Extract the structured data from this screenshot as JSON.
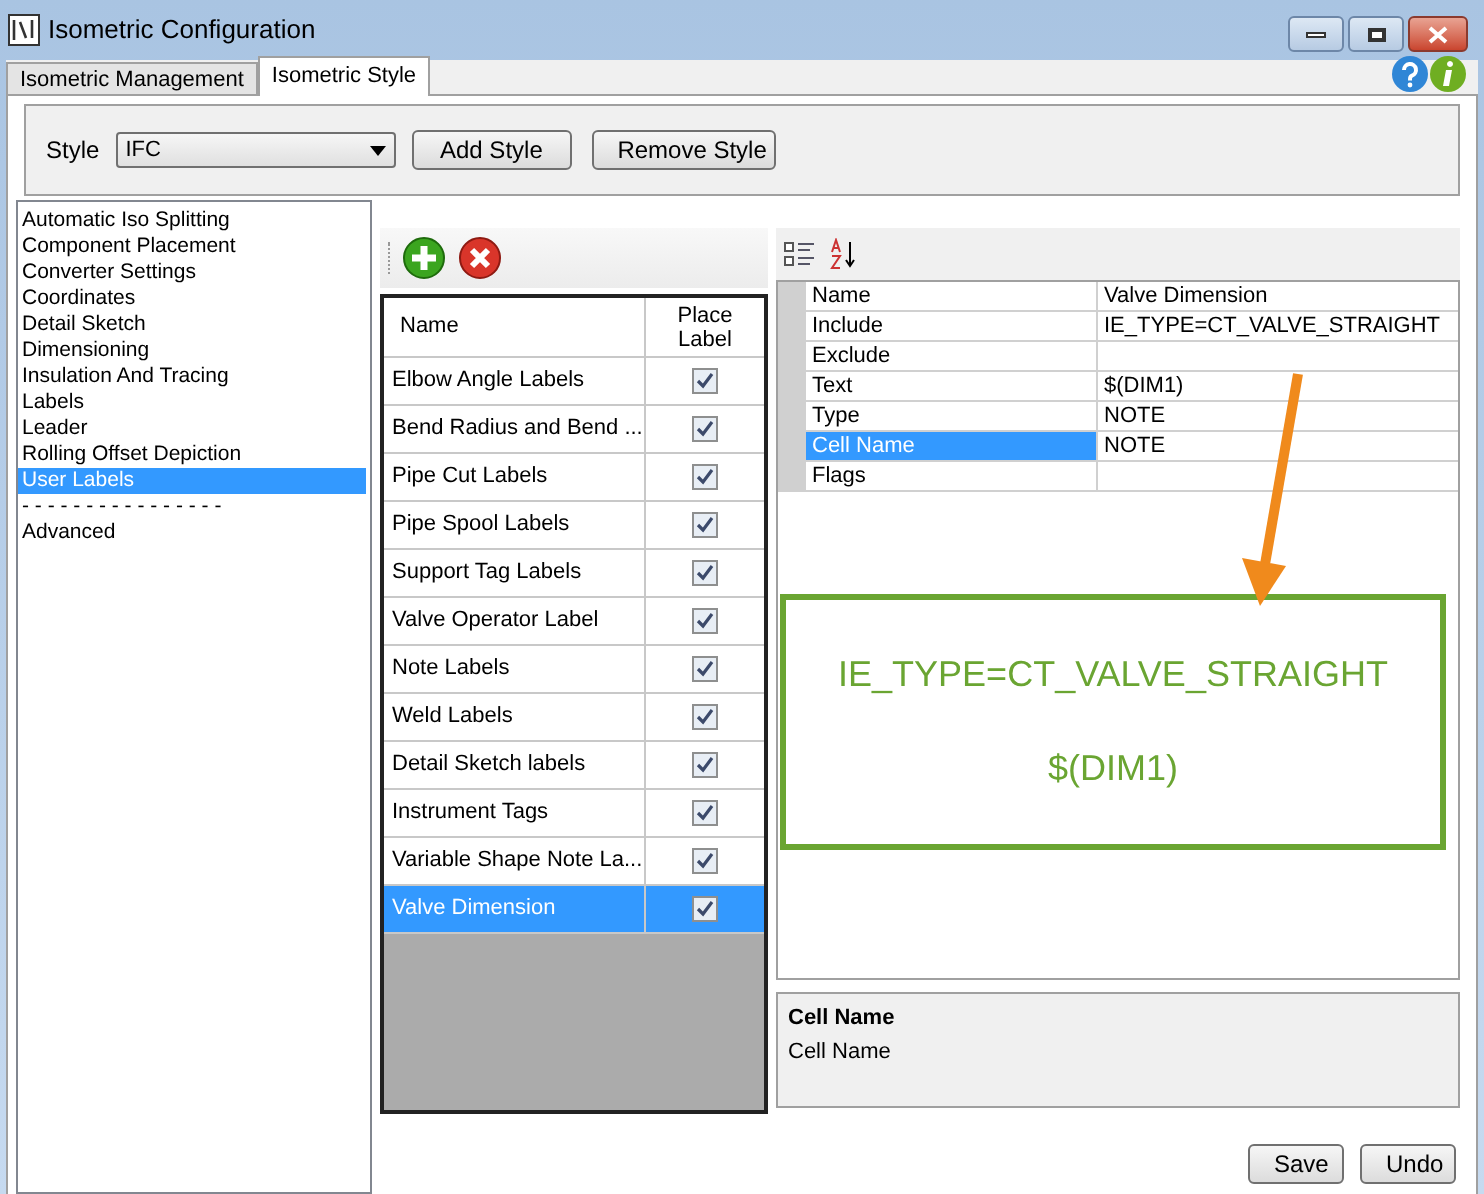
{
  "window": {
    "title": "Isometric Configuration"
  },
  "tabs": [
    {
      "label": "Isometric Management",
      "selected": false
    },
    {
      "label": "Isometric Style",
      "selected": true
    }
  ],
  "style_bar": {
    "label": "Style",
    "value": "IFC",
    "buttons": [
      "Add Style",
      "Remove Style"
    ]
  },
  "categories": [
    {
      "label": "Automatic Iso Splitting",
      "selected": false
    },
    {
      "label": "Component Placement",
      "selected": false
    },
    {
      "label": "Converter Settings",
      "selected": false
    },
    {
      "label": "Coordinates",
      "selected": false
    },
    {
      "label": "Detail Sketch",
      "selected": false
    },
    {
      "label": "Dimensioning",
      "selected": false
    },
    {
      "label": "Insulation And Tracing",
      "selected": false
    },
    {
      "label": "Labels",
      "selected": false
    },
    {
      "label": "Leader",
      "selected": false
    },
    {
      "label": "Rolling Offset Depiction",
      "selected": false
    },
    {
      "label": "User Labels",
      "selected": true
    },
    {
      "label": "- - - - - - - - - - - - - - - -",
      "selected": false
    },
    {
      "label": "Advanced",
      "selected": false
    }
  ],
  "labels_table": {
    "columns": [
      "Name",
      "Place Label"
    ],
    "rows": [
      {
        "name": "Elbow Angle Labels",
        "checked": true,
        "selected": false
      },
      {
        "name": "Bend Radius and Bend ...",
        "checked": true,
        "selected": false
      },
      {
        "name": "Pipe Cut Labels",
        "checked": true,
        "selected": false
      },
      {
        "name": "Pipe Spool Labels",
        "checked": true,
        "selected": false
      },
      {
        "name": "Support Tag Labels",
        "checked": true,
        "selected": false
      },
      {
        "name": "Valve Operator Label",
        "checked": true,
        "selected": false
      },
      {
        "name": "Note Labels",
        "checked": true,
        "selected": false
      },
      {
        "name": "Weld Labels",
        "checked": true,
        "selected": false
      },
      {
        "name": "Detail Sketch labels",
        "checked": true,
        "selected": false
      },
      {
        "name": "Instrument Tags",
        "checked": true,
        "selected": false
      },
      {
        "name": "Variable Shape Note La...",
        "checked": true,
        "selected": false
      },
      {
        "name": "Valve Dimension",
        "checked": true,
        "selected": true
      }
    ]
  },
  "properties": [
    {
      "name": "Name",
      "value": "Valve Dimension",
      "selected": false
    },
    {
      "name": "Include",
      "value": "IE_TYPE=CT_VALVE_STRAIGHT",
      "selected": false
    },
    {
      "name": "Exclude",
      "selected": false
    },
    {
      "name": "Text",
      "value": "$(DIM1)",
      "selected": false
    },
    {
      "name": "Type",
      "value": "NOTE",
      "selected": false
    },
    {
      "name": "Cell Name",
      "value": "NOTE",
      "selected": true
    },
    {
      "name": "Flags",
      "selected": false
    }
  ],
  "callout": {
    "lines": [
      "IE_TYPE=CT_VALVE_STRAIGHT",
      "$(DIM1)"
    ]
  },
  "description": {
    "title": "Cell Name",
    "text": "Cell Name"
  },
  "footer_buttons": [
    "Save",
    "Undo"
  ]
}
